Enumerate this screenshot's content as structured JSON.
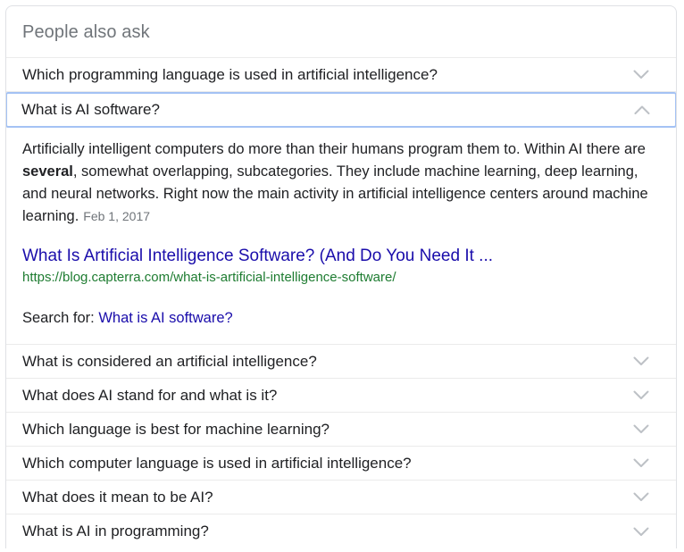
{
  "header": {
    "title": "People also ask"
  },
  "icons": {
    "collapsed": "chevron-down-icon",
    "expanded": "chevron-up-icon",
    "chevron_color": "#bdc1c6"
  },
  "colors": {
    "selected_border": "#a4c2f4",
    "divider": "#ebebeb",
    "card_border": "#dfe1e5",
    "title_gray": "#70757a",
    "link_blue": "#1a0dab",
    "url_green": "#1e7c31",
    "text": "#202124"
  },
  "questions_top": [
    {
      "text": "Which programming language is used in artificial intelligence?",
      "expanded": false
    }
  ],
  "expanded_question": {
    "text": "What is AI software?",
    "expanded": true,
    "answer": {
      "part1": "Artificially intelligent computers do more than their humans program them to. Within AI there are ",
      "bold": "several",
      "part2": ", somewhat overlapping, subcategories. They include machine learning, deep learning, and neural networks. Right now the main activity in artificial intelligence centers around machine learning.",
      "date": "Feb 1, 2017"
    },
    "result": {
      "title": "What Is Artificial Intelligence Software? (And Do You Need It ...",
      "url": "https://blog.capterra.com/what-is-artificial-intelligence-software/"
    },
    "search_for": {
      "label": "Search for:",
      "query": "What is AI software?"
    }
  },
  "questions_bottom": [
    {
      "text": "What is considered an artificial intelligence?",
      "expanded": false
    },
    {
      "text": "What does AI stand for and what is it?",
      "expanded": false
    },
    {
      "text": "Which language is best for machine learning?",
      "expanded": false
    },
    {
      "text": "Which computer language is used in artificial intelligence?",
      "expanded": false
    },
    {
      "text": "What does it mean to be AI?",
      "expanded": false
    },
    {
      "text": "What is AI in programming?",
      "expanded": false
    }
  ]
}
